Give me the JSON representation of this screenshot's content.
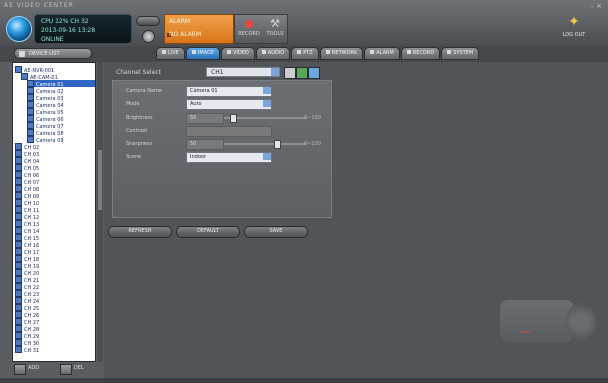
{
  "window": {
    "title": "AE VIDEO CENTER",
    "controls": "– ×"
  },
  "header": {
    "info_lines": [
      "CPU 12%  CH 32",
      "2013-09-16 13:28",
      "ONLINE"
    ],
    "alarm": {
      "title": "ALARM",
      "subtitle": "NO ALARM"
    },
    "tools": [
      {
        "label": "RECORD"
      },
      {
        "label": "TOOLS"
      }
    ],
    "logout_label": "LOG OUT",
    "colors": {
      "alarm": "#e0801f",
      "accent": "#3a7fc8",
      "tree_selection": "#3167c4"
    }
  },
  "tree": {
    "header_label": "DEVICE LIST",
    "items": [
      {
        "label": "AE-NVR-001",
        "level": 0
      },
      {
        "label": "AE-CAM-01",
        "level": 1
      },
      {
        "label": "Camera 01",
        "level": 2,
        "selected": true
      },
      {
        "label": "Camera 02",
        "level": 2
      },
      {
        "label": "Camera 03",
        "level": 2
      },
      {
        "label": "Camera 04",
        "level": 2
      },
      {
        "label": "Camera 05",
        "level": 2
      },
      {
        "label": "Camera 06",
        "level": 2
      },
      {
        "label": "Camera 07",
        "level": 2
      },
      {
        "label": "Camera 08",
        "level": 2
      },
      {
        "label": "Camera 09",
        "level": 2
      },
      {
        "label": "CH 02",
        "level": 0
      },
      {
        "label": "CH 03",
        "level": 0
      },
      {
        "label": "CH 04",
        "level": 0
      },
      {
        "label": "CH 05",
        "level": 0
      },
      {
        "label": "CH 06",
        "level": 0
      },
      {
        "label": "CH 07",
        "level": 0
      },
      {
        "label": "CH 08",
        "level": 0
      },
      {
        "label": "CH 09",
        "level": 0
      },
      {
        "label": "CH 10",
        "level": 0
      },
      {
        "label": "CH 11",
        "level": 0
      },
      {
        "label": "CH 12",
        "level": 0
      },
      {
        "label": "CH 13",
        "level": 0
      },
      {
        "label": "CH 14",
        "level": 0
      },
      {
        "label": "CH 15",
        "level": 0
      },
      {
        "label": "CH 16",
        "level": 0
      },
      {
        "label": "CH 17",
        "level": 0
      },
      {
        "label": "CH 18",
        "level": 0
      },
      {
        "label": "CH 19",
        "level": 0
      },
      {
        "label": "CH 20",
        "level": 0
      },
      {
        "label": "CH 21",
        "level": 0
      },
      {
        "label": "CH 22",
        "level": 0
      },
      {
        "label": "CH 23",
        "level": 0
      },
      {
        "label": "CH 24",
        "level": 0
      },
      {
        "label": "CH 25",
        "level": 0
      },
      {
        "label": "CH 26",
        "level": 0
      },
      {
        "label": "CH 27",
        "level": 0
      },
      {
        "label": "CH 28",
        "level": 0
      },
      {
        "label": "CH 29",
        "level": 0
      },
      {
        "label": "CH 30",
        "level": 0
      },
      {
        "label": "CH 31",
        "level": 0
      }
    ],
    "footer": [
      "ADD",
      "DEL"
    ]
  },
  "tabs": [
    {
      "label": "LIVE"
    },
    {
      "label": "IMAGE",
      "active": true
    },
    {
      "label": "VIDEO"
    },
    {
      "label": "AUDIO"
    },
    {
      "label": "PTZ"
    },
    {
      "label": "NETWORK"
    },
    {
      "label": "ALARM"
    },
    {
      "label": "RECORD"
    },
    {
      "label": "SYSTEM"
    }
  ],
  "main": {
    "channel_label": "Channel Select",
    "channel_value": "CH1",
    "fields": [
      {
        "label": "Camera Name",
        "value": "Camera 01"
      },
      {
        "label": "Mode",
        "value": "Auto"
      },
      {
        "label": "Brightness",
        "value": "50",
        "unit": "0~100"
      },
      {
        "label": "Contrast",
        "value": ""
      },
      {
        "label": "Sharpness",
        "value": "50",
        "unit": "0~100"
      },
      {
        "label": "Scene",
        "value": "Indoor"
      }
    ],
    "buttons": [
      "REFRESH",
      "DEFAULT",
      "SAVE"
    ]
  }
}
